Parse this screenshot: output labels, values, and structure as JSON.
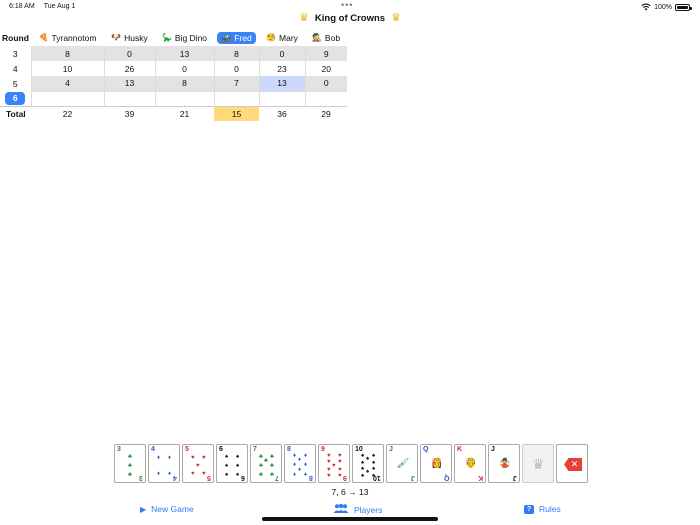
{
  "status": {
    "time": "6:18 AM",
    "date": "Tue Aug 1",
    "battery": "100%",
    "dots": "•••"
  },
  "title": {
    "text": "King of Crowns",
    "icon": "crown-icon",
    "accent": "#e7b416"
  },
  "table": {
    "round_header": "Round",
    "players": [
      {
        "emoji": "🍕",
        "name": "Tyrannotom",
        "active": false
      },
      {
        "emoji": "🐶",
        "name": "Husky",
        "active": false
      },
      {
        "emoji": "🦕",
        "name": "Big Dino",
        "active": false
      },
      {
        "emoji": "🚜",
        "name": "Fred",
        "active": true
      },
      {
        "emoji": "🧐",
        "name": "Mary",
        "active": false
      },
      {
        "emoji": "🕵",
        "name": "Bob",
        "active": false
      }
    ],
    "rows": [
      {
        "round": "3",
        "scores": [
          "8",
          "0",
          "13",
          "8",
          "0",
          "9"
        ]
      },
      {
        "round": "4",
        "scores": [
          "10",
          "26",
          "0",
          "0",
          "23",
          "20"
        ]
      },
      {
        "round": "5",
        "scores": [
          "4",
          "13",
          "8",
          "7",
          "13",
          "0"
        ]
      }
    ],
    "current_round": "6",
    "total_label": "Total",
    "totals": [
      "22",
      "39",
      "21",
      "15",
      "36",
      "29"
    ],
    "colors": {
      "active": "#3a82f6",
      "leader": "#ffd97a",
      "selected": "#ccd8fa",
      "shade": "#e3e3e3"
    }
  },
  "cards": [
    {
      "rank": "3",
      "suit": "♣",
      "color": "green"
    },
    {
      "rank": "4",
      "suit": "♦",
      "color": "blue"
    },
    {
      "rank": "5",
      "suit": "♥",
      "color": "red"
    },
    {
      "rank": "6",
      "suit": "♠",
      "color": "black"
    },
    {
      "rank": "7",
      "suit": "♣",
      "color": "green"
    },
    {
      "rank": "8",
      "suit": "♦",
      "color": "blue"
    },
    {
      "rank": "9",
      "suit": "♥",
      "color": "red"
    },
    {
      "rank": "10",
      "suit": "♠",
      "color": "black"
    },
    {
      "rank": "J",
      "suit": "♣",
      "color": "green",
      "face": "🖌"
    },
    {
      "rank": "Q",
      "suit": "♦",
      "color": "blue",
      "face": "👸"
    },
    {
      "rank": "K",
      "suit": "♥",
      "color": "red",
      "face": "🤴"
    },
    {
      "rank": "J",
      "suit": "♠",
      "color": "black",
      "face": "🤹"
    }
  ],
  "hand_readout": {
    "cards": "7, 6",
    "arrow": "→",
    "points": "13"
  },
  "tabs": {
    "new_game": "New Game",
    "players": "Players",
    "rules": "Rules",
    "tint": "#2f7cf6"
  }
}
